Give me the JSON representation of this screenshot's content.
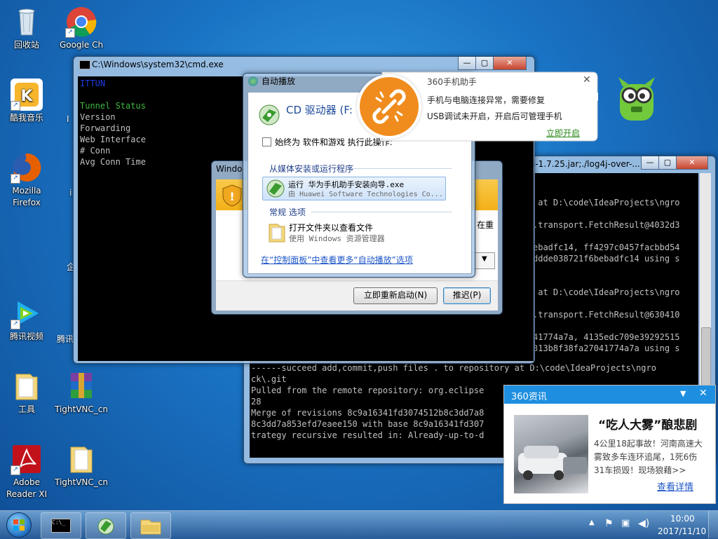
{
  "desktop_icons": [
    {
      "label": "回收站",
      "icon": "recycle-bin-icon"
    },
    {
      "label": "Google Ch",
      "icon": "chrome-icon"
    },
    {
      "label": "酷我音乐",
      "icon": "kuwo-music-icon"
    },
    {
      "label": "Mozilla Firefox",
      "icon": "firefox-icon"
    },
    {
      "label": "腾讯视频",
      "icon": "tencent-video-icon"
    },
    {
      "label": "工具",
      "icon": "folder-icon"
    },
    {
      "label": "TightVNC_cn",
      "icon": "winrar-icon"
    },
    {
      "label": "Adobe Reader XI",
      "icon": "adobe-reader-icon"
    },
    {
      "label": "TightVNC_cn",
      "icon": "folder-icon"
    }
  ],
  "partial_icon_labels": [
    "I",
    "i",
    "企",
    "腾讯"
  ],
  "cmd": {
    "title": "C:\\Windows\\system32\\cmd.exe",
    "lines": [
      {
        "text": "ITTUN",
        "color": "#1e3ce6"
      },
      {
        "text": "",
        "color": "#c0c0c0"
      },
      {
        "text": "Tunnel Status",
        "color": "#3fb83f"
      },
      {
        "text": "Version",
        "color": "#c0c0c0"
      },
      {
        "text": "Forwarding",
        "color": "#c0c0c0"
      },
      {
        "text": "Web Interface",
        "color": "#c0c0c0"
      },
      {
        "text": "# Conn",
        "color": "#c0c0c0"
      },
      {
        "text": "Avg Conn Time",
        "color": "#c0c0c0"
      }
    ]
  },
  "console2": {
    "title": "i-1.7.25.jar;./log4j-over-...",
    "lines": [
      "",
      "",
      " at D:\\code\\IdeaProjects\\ngro",
      "",
      ".transport.FetchResult@4032d3",
      "",
      "ebadfc14, ff4297c0457facbbd54",
      "ddde038721f6bebadfc14 using s",
      "",
      "",
      " at D:\\code\\IdeaProjects\\ngro",
      "",
      ".transport.FetchResult@630410",
      "",
      "41774a7a, 4135edc709e39292515",
      "313b8f38fa27041774a7a using s"
    ],
    "bottom_lines": [
      "------succeed add,commit,push files . to repository at D:\\code\\IdeaProjects\\ngro",
      "ck\\.git",
      "Pulled from the remote repository: org.eclipse",
      "28",
      "Merge of revisions 8c9a16341fd3074512b8c3dd7a8",
      "8c3dd7a853efd7eaee150 with base 8c9a16341fd307",
      "trategy recursive resulted in: Already-up-to-d"
    ]
  },
  "win_dialog": {
    "title": "Windo",
    "side_text": "在重",
    "restart_button": "立即重新启动(N)",
    "defer_button": "推迟(P)"
  },
  "autoplay": {
    "title": "自动播放",
    "drive": "CD 驱动器 (F:",
    "always_do": "始终为 软件和游戏 执行此操作:",
    "section_install": "从媒体安装或运行程序",
    "run_title": "运行 华为手机助手安装向导.exe",
    "run_sub": "由 Huawei Software Technologies Co...",
    "section_general": "常规 选项",
    "open_folder_title": "打开文件夹以查看文件",
    "open_folder_sub": "使用 Windows 资源管理器",
    "more_link": "在“控制面板”中查看更多“自动播放”选项"
  },
  "popup360": {
    "title": "360手机助手",
    "line1": "手机与电脑连接异常，需要修复",
    "line2": "USB调试未开启，开启后可管理手机",
    "action": "立即开启",
    "accent": "#f08c1e"
  },
  "news360": {
    "title": "360资讯",
    "headline": "“吃人大雾”酿悲剧",
    "body": "4公里18起事故！河南高速大雾致多车连环追尾，1死6伤31车损毁！现场狼藉>>",
    "link": "查看详情"
  },
  "tray": {
    "time": "10:00",
    "date": "2017/11/10"
  }
}
